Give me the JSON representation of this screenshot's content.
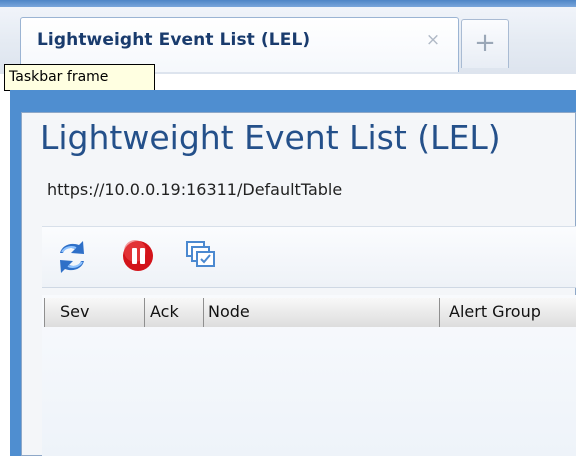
{
  "tab": {
    "title": "Lightweight Event List (LEL)",
    "close_icon": "×",
    "add_icon": "+"
  },
  "tooltip": {
    "text": "Taskbar frame"
  },
  "panel": {
    "title": "Lightweight Event List (LEL)",
    "url": "https://10.0.0.19:16311/DefaultTable"
  },
  "toolbar": {
    "icons": [
      {
        "name": "refresh-icon",
        "color": "#2c6fc6"
      },
      {
        "name": "pause-icon",
        "color": "#d3141a"
      },
      {
        "name": "multi-window-icon",
        "color": "#4b89d0"
      }
    ]
  },
  "table": {
    "columns": [
      "Sev",
      "Ack",
      "Node",
      "Alert Group"
    ]
  },
  "colors": {
    "accent": "#4f8ed0",
    "title_blue": "#24508a",
    "tab_text": "#193b6d",
    "pause_red": "#d3141a"
  }
}
